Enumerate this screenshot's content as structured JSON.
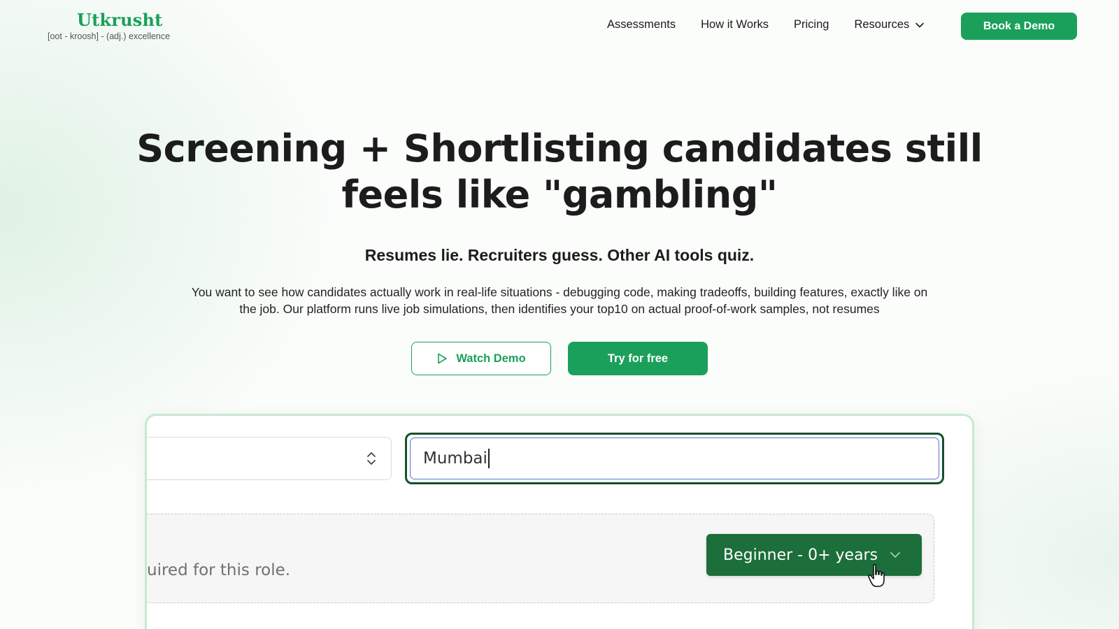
{
  "header": {
    "brand_name": "Utkrusht",
    "brand_tagline": "[oot - kroosh] - (adj.) excellence",
    "nav": [
      {
        "label": "Assessments"
      },
      {
        "label": "How it Works"
      },
      {
        "label": "Pricing"
      },
      {
        "label": "Resources",
        "icon": "chevron-down-icon"
      }
    ],
    "cta_label": "Book a Demo"
  },
  "hero": {
    "title_line1": "Screening + Shortlisting candidates still",
    "title_line2": "feels like \"gambling\"",
    "subtitle": "Resumes lie. Recruiters guess. Other AI tools quiz.",
    "description_line1": "You want to see how candidates actually work in real-life situations - debugging code, making tradeoffs, building features, exactly like on",
    "description_line2": "the job. Our platform runs live job simulations, then identifies your top10 on actual proof-of-work samples, not resumes",
    "watch_demo_label": "Watch Demo",
    "try_label": "Try for free"
  },
  "demo": {
    "location_value": "Mumbai",
    "experience_hint": "uired for this role.",
    "experience_selected": "Beginner - 0+ years"
  },
  "colors": {
    "brand": "#1aa05a",
    "dark_green": "#1c6e3a",
    "focus_ring": "#15502e"
  }
}
